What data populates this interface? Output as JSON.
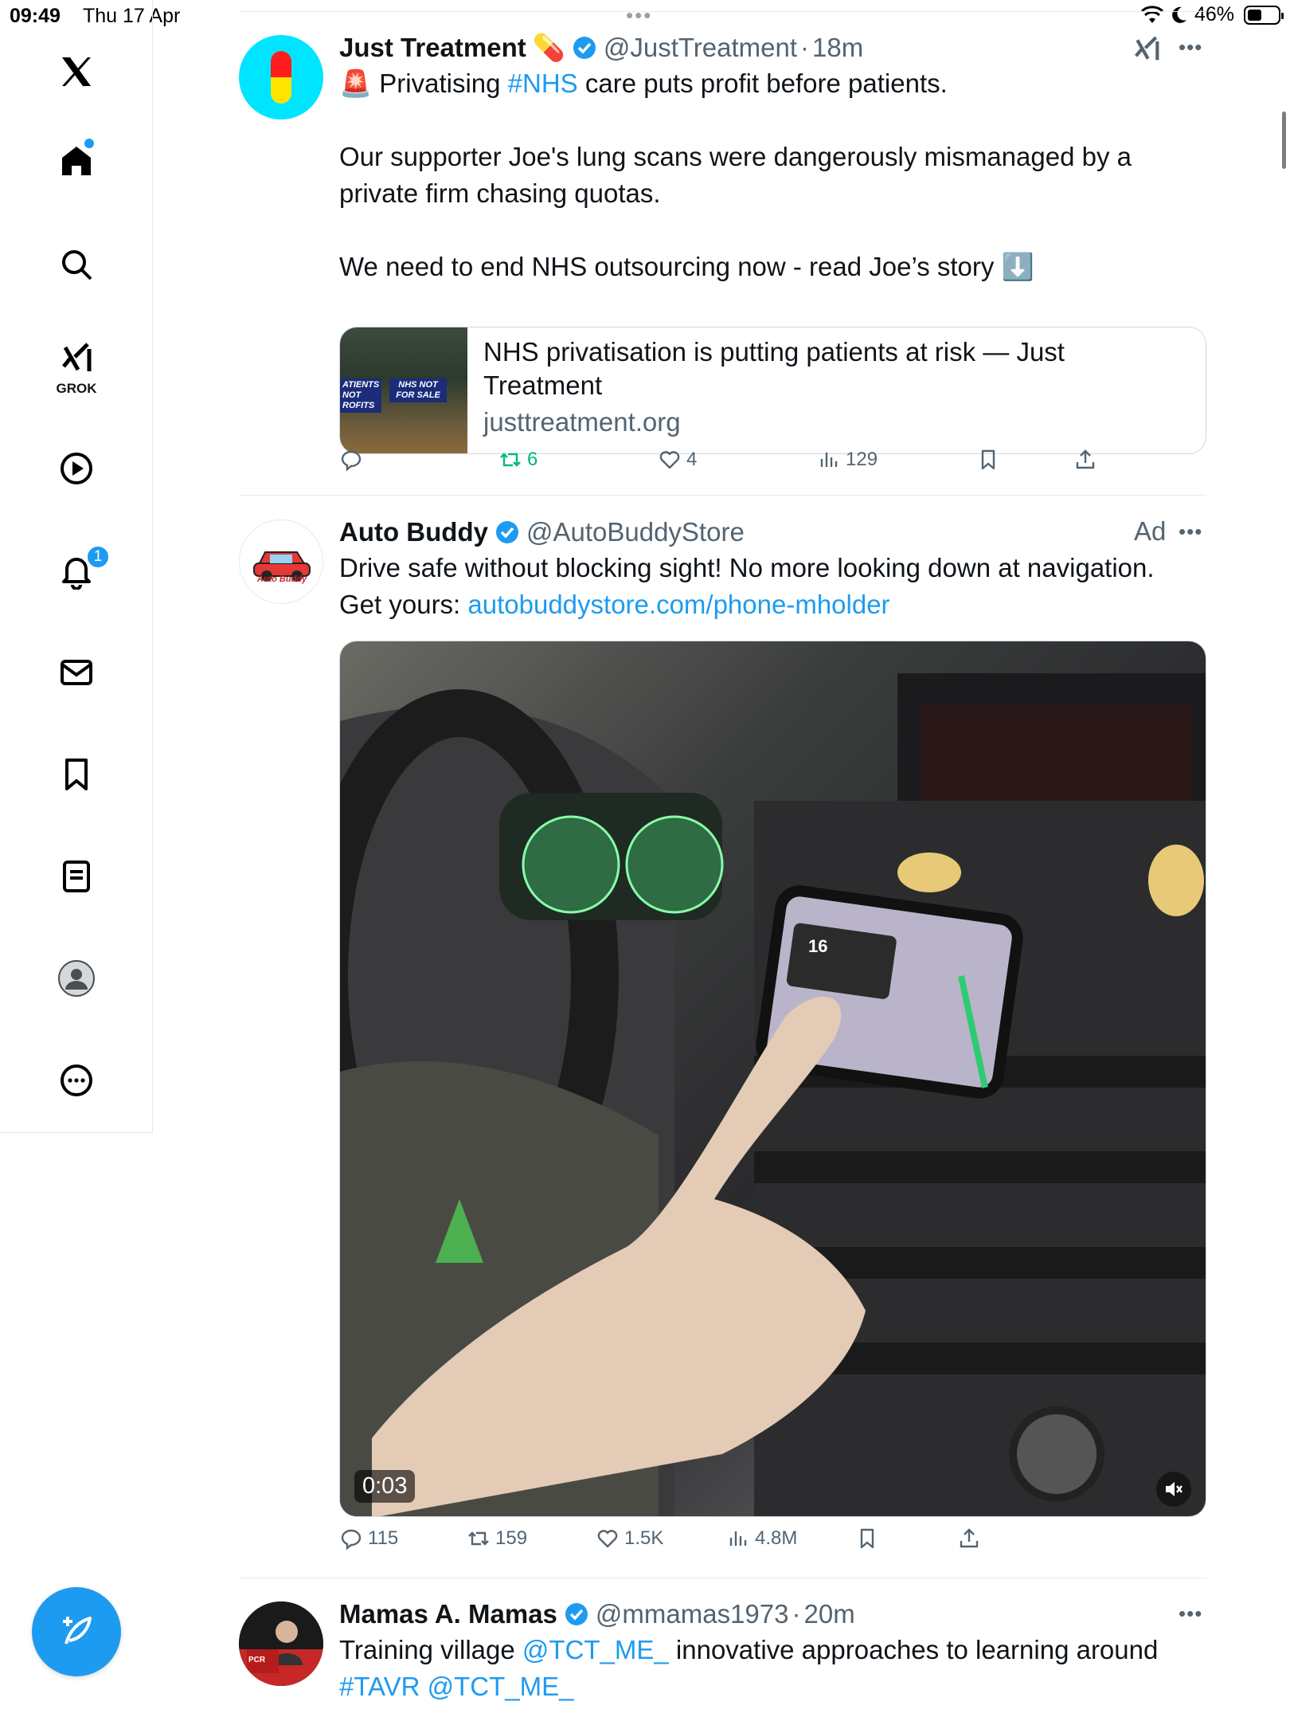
{
  "status_bar": {
    "time": "09:49",
    "date": "Thu 17 Apr",
    "battery": "46%",
    "battery_level": 0.46
  },
  "sidebar": {
    "items": [
      {
        "icon": "x-logo-icon"
      },
      {
        "icon": "home-icon"
      },
      {
        "icon": "search-icon"
      },
      {
        "icon": "grok-icon",
        "label": "GROK"
      },
      {
        "icon": "video-play-icon"
      },
      {
        "icon": "notifications-bell-icon",
        "badge": "1"
      },
      {
        "icon": "messages-mail-icon"
      },
      {
        "icon": "bookmarks-icon"
      },
      {
        "icon": "lists-icon"
      },
      {
        "icon": "profile-avatar-icon"
      },
      {
        "icon": "more-circle-icon"
      }
    ],
    "compose_icon": "compose-quill-icon"
  },
  "colors": {
    "accent": "#1d9bf0",
    "text": "#0f1419",
    "muted": "#536471",
    "retweet_active": "#00ba7c"
  },
  "tweets": [
    {
      "name": "Just Treatment",
      "name_emoji": "💊",
      "handle": "@JustTreatment",
      "separator": "·",
      "time": "18m",
      "text_line1_emoji": "🚨",
      "text_line1_pre": "Privatising ",
      "text_line1_hashtag": "#NHS",
      "text_line1_post": " care puts profit before patients.",
      "text_para2": "Our supporter Joe's lung scans were dangerously mismanaged by a private firm chasing quotas.",
      "text_para3": "We need to end NHS outsourcing now - read Joe’s story",
      "text_para3_emoji": "⬇️",
      "card": {
        "title": "NHS privatisation is putting patients at risk — Just Treatment",
        "domain": "justtreatment.org",
        "sign_left": "ATIENTS NOT ROFITS",
        "sign_right": "NHS NOT FOR SALE"
      },
      "stats": {
        "replies": "",
        "retweets": "6",
        "likes": "4",
        "views": "129"
      }
    },
    {
      "name": "Auto Buddy",
      "handle": "@AutoBuddyStore",
      "ad": "Ad",
      "avatar_label": "Auto Buddy",
      "text_line1": "Drive safe without blocking sight! No more looking down at navigation.",
      "text_line2_pre": "Get yours: ",
      "text_line2_link": "autobuddystore.com/phone-mholder",
      "video": {
        "duration": "0:03",
        "phone_label": "16"
      },
      "stats": {
        "replies": "115",
        "retweets": "159",
        "likes": "1.5K",
        "views": "4.8M"
      }
    },
    {
      "name": "Mamas A. Mamas",
      "handle": "@mmamas1973",
      "separator": "·",
      "time": "20m",
      "text_pre": "Training village ",
      "text_link1": "@TCT_ME_",
      "text_mid": " innovative approaches to learning around",
      "text_link2": "#TAVR",
      "text_space": " ",
      "text_link3": "@TCT_ME_",
      "avatar_sign": "PCR"
    }
  ]
}
